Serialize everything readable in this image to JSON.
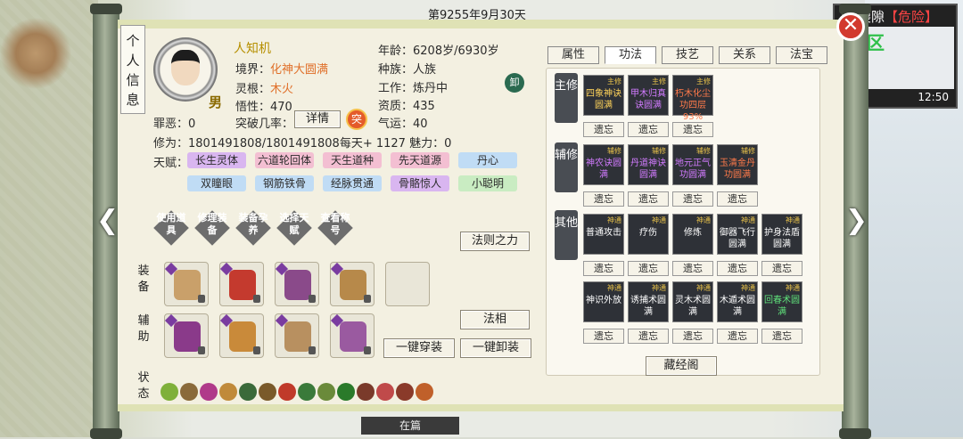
{
  "topbar": {
    "date": "第9255年9月30天"
  },
  "corner": {
    "title": "裂隙",
    "danger": "【危险】",
    "zone": "区",
    "time": "12:50"
  },
  "bottom": {
    "label": "在篇"
  },
  "side_tag": "个人信息",
  "profile": {
    "name": "人知机",
    "gender": "男",
    "realm_label": "境界：",
    "realm": "化神大圆满",
    "root_label": "灵根：",
    "root": "木火",
    "wisdom_label": "悟性：",
    "wisdom": "470",
    "breakthrough_label": "突破几率：",
    "detail_btn": "详情",
    "seal": "突",
    "age_label": "年龄：",
    "age": "6208岁/6930岁",
    "race_label": "种族：",
    "race": "人族",
    "job_label": "工作：",
    "job": "炼丹中",
    "job_seal": "卸",
    "aptitude_label": "资质：",
    "aptitude": "435",
    "luck_label": "气运：",
    "luck": "40",
    "sin_label": "罪恶：",
    "sin": "0",
    "cult_label": "修为：",
    "cult": "1801491808/1801491808每天+ 1127",
    "charm_label": "魅力：",
    "charm": "0",
    "talent_label": "天赋："
  },
  "talents": [
    {
      "name": "长生灵体",
      "color": "#d9b6f0"
    },
    {
      "name": "六道轮回体",
      "color": "#f3bfd2"
    },
    {
      "name": "天生道种",
      "color": "#f3bfd2"
    },
    {
      "name": "先天道源",
      "color": "#f3bfd2"
    },
    {
      "name": "丹心",
      "color": "#c0dcf5"
    },
    {
      "name": "双瞳眼",
      "color": "#c0dcf5"
    },
    {
      "name": "钢筋铁骨",
      "color": "#c0dcf5"
    },
    {
      "name": "经脉贯通",
      "color": "#c0dcf5"
    },
    {
      "name": "骨骼惊人",
      "color": "#d9b6f0"
    },
    {
      "name": "小聪明",
      "color": "#c9ecc2"
    }
  ],
  "actions": [
    "使用道具",
    "修理装备",
    "装备孕养",
    "选择天赋",
    "查看称号"
  ],
  "law_btn": "法则之力",
  "equip_label": "装备",
  "aux_label": "辅助",
  "faxiang_btn": "法相",
  "equip_all": "一键穿装",
  "unequip_all": "一键卸装",
  "status_label": "状态",
  "tabs": [
    "属性",
    "功法",
    "技艺",
    "关系",
    "法宝"
  ],
  "categories": {
    "main": "主修",
    "aux": "辅修",
    "other": "其他"
  },
  "main_skills": [
    {
      "name": "四象神诀圆满",
      "tier": "主修",
      "cls": "yellow"
    },
    {
      "name": "甲木归真诀圆满",
      "tier": "主修",
      "cls": "purple"
    },
    {
      "name": "朽木化尘功四层 93%",
      "tier": "主修",
      "cls": "red"
    }
  ],
  "aux_skills": [
    {
      "name": "神农诀圆满",
      "tier": "辅修",
      "cls": "purple"
    },
    {
      "name": "丹道神诀圆满",
      "tier": "辅修",
      "cls": "purple"
    },
    {
      "name": "地元正气功圆满",
      "tier": "辅修",
      "cls": "purple"
    },
    {
      "name": "玉清金丹功圆满",
      "tier": "辅修",
      "cls": "red"
    }
  ],
  "other_row1": [
    {
      "name": "普通攻击",
      "tier": "神通"
    },
    {
      "name": "疗伤",
      "tier": "神通"
    },
    {
      "name": "修炼",
      "tier": "神通"
    },
    {
      "name": "御器飞行圆满",
      "tier": "神通"
    },
    {
      "name": "护身法盾圆满",
      "tier": "神通"
    }
  ],
  "other_row2": [
    {
      "name": "神识外放",
      "tier": "神通"
    },
    {
      "name": "诱捕术圆满",
      "tier": "神通"
    },
    {
      "name": "灵木术圆满",
      "tier": "神通"
    },
    {
      "name": "木遁术圆满",
      "tier": "神通"
    },
    {
      "name": "回春术圆满",
      "tier": "神通",
      "cls": "green"
    }
  ],
  "forget": "遗忘",
  "library_btn": "藏经阁"
}
